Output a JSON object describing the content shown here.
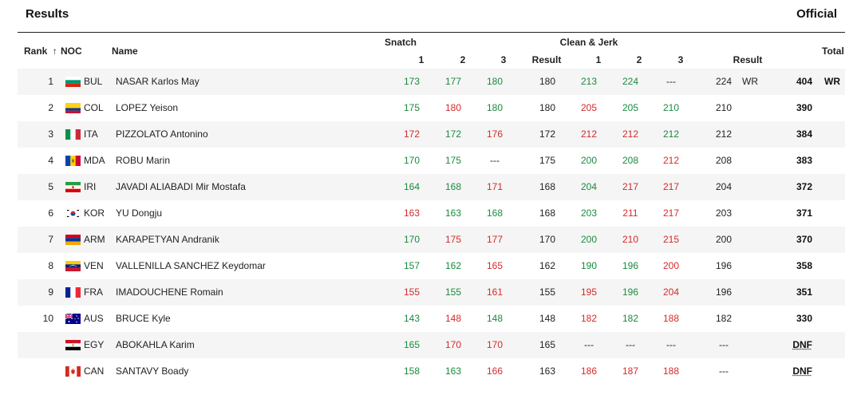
{
  "header": {
    "title": "Results",
    "status": "Official"
  },
  "columns": {
    "rank": "Rank",
    "rank_sort_icon": "up-arrow-icon",
    "noc": "NOC",
    "name": "Name",
    "snatch": "Snatch",
    "clean_jerk": "Clean & Jerk",
    "attempt1": "1",
    "attempt2": "2",
    "attempt3": "3",
    "result": "Result",
    "total": "Total"
  },
  "colors": {
    "good_lift": "#1a8a3f",
    "no_lift": "#d42a2a"
  },
  "rows": [
    {
      "rank": "1",
      "noc": "BUL",
      "name": "NASAR Karlos May",
      "sn": [
        {
          "v": "173",
          "s": "good"
        },
        {
          "v": "177",
          "s": "good"
        },
        {
          "v": "180",
          "s": "good"
        }
      ],
      "sn_result": "180",
      "cj": [
        {
          "v": "213",
          "s": "good"
        },
        {
          "v": "224",
          "s": "good"
        },
        {
          "v": "---",
          "s": "none"
        }
      ],
      "cj_result": "224",
      "cj_record": "WR",
      "total": "404",
      "total_record": "WR"
    },
    {
      "rank": "2",
      "noc": "COL",
      "name": "LOPEZ Yeison",
      "sn": [
        {
          "v": "175",
          "s": "good"
        },
        {
          "v": "180",
          "s": "nolift"
        },
        {
          "v": "180",
          "s": "good"
        }
      ],
      "sn_result": "180",
      "cj": [
        {
          "v": "205",
          "s": "nolift"
        },
        {
          "v": "205",
          "s": "good"
        },
        {
          "v": "210",
          "s": "good"
        }
      ],
      "cj_result": "210",
      "cj_record": "",
      "total": "390",
      "total_record": ""
    },
    {
      "rank": "3",
      "noc": "ITA",
      "name": "PIZZOLATO Antonino",
      "sn": [
        {
          "v": "172",
          "s": "nolift"
        },
        {
          "v": "172",
          "s": "good"
        },
        {
          "v": "176",
          "s": "nolift"
        }
      ],
      "sn_result": "172",
      "cj": [
        {
          "v": "212",
          "s": "nolift"
        },
        {
          "v": "212",
          "s": "nolift"
        },
        {
          "v": "212",
          "s": "good"
        }
      ],
      "cj_result": "212",
      "cj_record": "",
      "total": "384",
      "total_record": ""
    },
    {
      "rank": "4",
      "noc": "MDA",
      "name": "ROBU Marin",
      "sn": [
        {
          "v": "170",
          "s": "good"
        },
        {
          "v": "175",
          "s": "good"
        },
        {
          "v": "---",
          "s": "none"
        }
      ],
      "sn_result": "175",
      "cj": [
        {
          "v": "200",
          "s": "good"
        },
        {
          "v": "208",
          "s": "good"
        },
        {
          "v": "212",
          "s": "nolift"
        }
      ],
      "cj_result": "208",
      "cj_record": "",
      "total": "383",
      "total_record": ""
    },
    {
      "rank": "5",
      "noc": "IRI",
      "name": "JAVADI ALIABADI Mir Mostafa",
      "sn": [
        {
          "v": "164",
          "s": "good"
        },
        {
          "v": "168",
          "s": "good"
        },
        {
          "v": "171",
          "s": "nolift"
        }
      ],
      "sn_result": "168",
      "cj": [
        {
          "v": "204",
          "s": "good"
        },
        {
          "v": "217",
          "s": "nolift"
        },
        {
          "v": "217",
          "s": "nolift"
        }
      ],
      "cj_result": "204",
      "cj_record": "",
      "total": "372",
      "total_record": ""
    },
    {
      "rank": "6",
      "noc": "KOR",
      "name": "YU Dongju",
      "sn": [
        {
          "v": "163",
          "s": "nolift"
        },
        {
          "v": "163",
          "s": "good"
        },
        {
          "v": "168",
          "s": "good"
        }
      ],
      "sn_result": "168",
      "cj": [
        {
          "v": "203",
          "s": "good"
        },
        {
          "v": "211",
          "s": "nolift"
        },
        {
          "v": "217",
          "s": "nolift"
        }
      ],
      "cj_result": "203",
      "cj_record": "",
      "total": "371",
      "total_record": ""
    },
    {
      "rank": "7",
      "noc": "ARM",
      "name": "KARAPETYAN Andranik",
      "sn": [
        {
          "v": "170",
          "s": "good"
        },
        {
          "v": "175",
          "s": "nolift"
        },
        {
          "v": "177",
          "s": "nolift"
        }
      ],
      "sn_result": "170",
      "cj": [
        {
          "v": "200",
          "s": "good"
        },
        {
          "v": "210",
          "s": "nolift"
        },
        {
          "v": "215",
          "s": "nolift"
        }
      ],
      "cj_result": "200",
      "cj_record": "",
      "total": "370",
      "total_record": ""
    },
    {
      "rank": "8",
      "noc": "VEN",
      "name": "VALLENILLA SANCHEZ Keydomar",
      "sn": [
        {
          "v": "157",
          "s": "good"
        },
        {
          "v": "162",
          "s": "good"
        },
        {
          "v": "165",
          "s": "nolift"
        }
      ],
      "sn_result": "162",
      "cj": [
        {
          "v": "190",
          "s": "good"
        },
        {
          "v": "196",
          "s": "good"
        },
        {
          "v": "200",
          "s": "nolift"
        }
      ],
      "cj_result": "196",
      "cj_record": "",
      "total": "358",
      "total_record": ""
    },
    {
      "rank": "9",
      "noc": "FRA",
      "name": "IMADOUCHENE Romain",
      "sn": [
        {
          "v": "155",
          "s": "nolift"
        },
        {
          "v": "155",
          "s": "good"
        },
        {
          "v": "161",
          "s": "nolift"
        }
      ],
      "sn_result": "155",
      "cj": [
        {
          "v": "195",
          "s": "nolift"
        },
        {
          "v": "196",
          "s": "good"
        },
        {
          "v": "204",
          "s": "nolift"
        }
      ],
      "cj_result": "196",
      "cj_record": "",
      "total": "351",
      "total_record": ""
    },
    {
      "rank": "10",
      "noc": "AUS",
      "name": "BRUCE Kyle",
      "sn": [
        {
          "v": "143",
          "s": "good"
        },
        {
          "v": "148",
          "s": "nolift"
        },
        {
          "v": "148",
          "s": "good"
        }
      ],
      "sn_result": "148",
      "cj": [
        {
          "v": "182",
          "s": "nolift"
        },
        {
          "v": "182",
          "s": "good"
        },
        {
          "v": "188",
          "s": "nolift"
        }
      ],
      "cj_result": "182",
      "cj_record": "",
      "total": "330",
      "total_record": ""
    },
    {
      "rank": "",
      "noc": "EGY",
      "name": "ABOKAHLA Karim",
      "sn": [
        {
          "v": "165",
          "s": "good"
        },
        {
          "v": "170",
          "s": "nolift"
        },
        {
          "v": "170",
          "s": "nolift"
        }
      ],
      "sn_result": "165",
      "cj": [
        {
          "v": "---",
          "s": "none"
        },
        {
          "v": "---",
          "s": "none"
        },
        {
          "v": "---",
          "s": "none"
        }
      ],
      "cj_result": "---",
      "cj_record": "",
      "total": "DNF",
      "total_record": ""
    },
    {
      "rank": "",
      "noc": "CAN",
      "name": "SANTAVY Boady",
      "sn": [
        {
          "v": "158",
          "s": "good"
        },
        {
          "v": "163",
          "s": "good"
        },
        {
          "v": "166",
          "s": "nolift"
        }
      ],
      "sn_result": "163",
      "cj": [
        {
          "v": "186",
          "s": "nolift"
        },
        {
          "v": "187",
          "s": "nolift"
        },
        {
          "v": "188",
          "s": "nolift"
        }
      ],
      "cj_result": "---",
      "cj_record": "",
      "total": "DNF",
      "total_record": ""
    }
  ]
}
